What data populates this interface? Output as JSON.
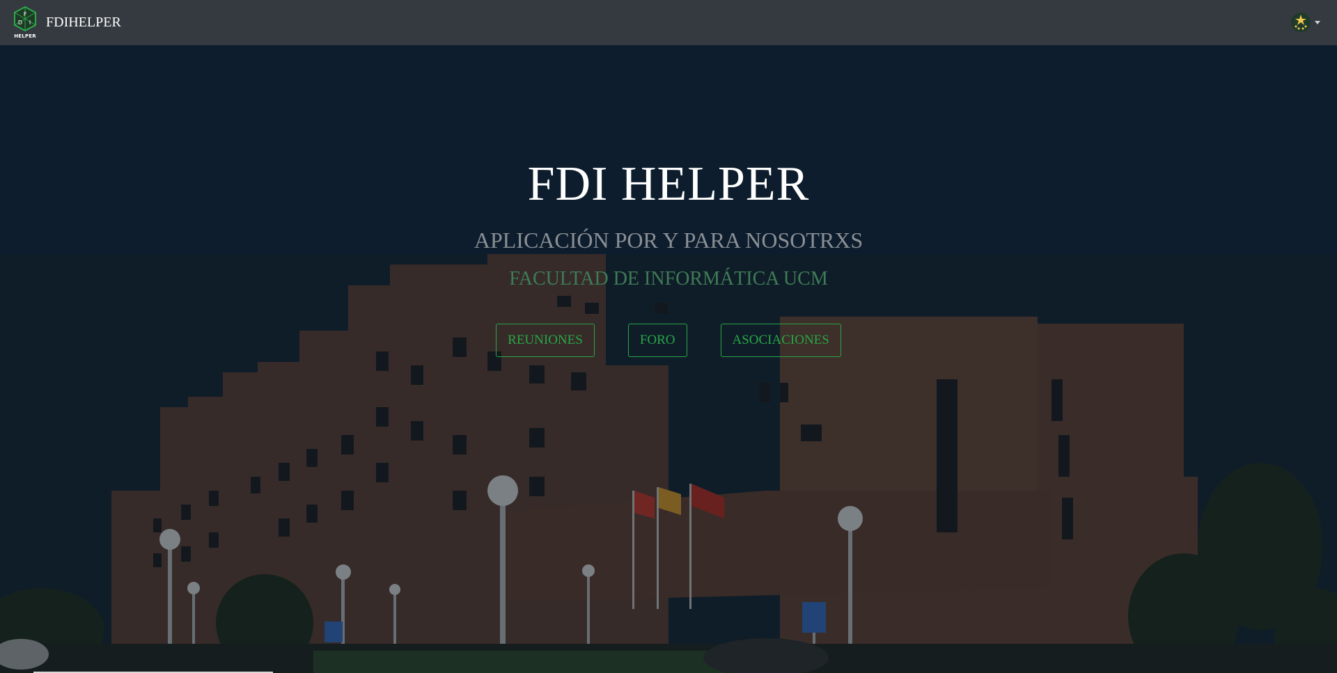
{
  "navbar": {
    "logo_letters": [
      "F",
      "D",
      "I"
    ],
    "logo_caption": "HELPER",
    "brand_text": "FDIHELPER",
    "user_menu_icon": "user-avatar-icon",
    "dropdown_icon": "chevron-down-icon"
  },
  "hero": {
    "title": "FDI HELPER",
    "subtitle": "APLICACIÓN POR Y PARA NOSOTRXS",
    "faculty": "FACULTAD DE INFORMÁTICA UCM",
    "buttons": [
      {
        "label": "REUNIONES"
      },
      {
        "label": "FORO"
      },
      {
        "label": "ASOCIACIONES"
      }
    ],
    "background_image": "faculty-building-photo"
  },
  "colors": {
    "navbar_bg": "#343a40",
    "accent_green": "#28a745",
    "title_white": "#ffffff",
    "subtitle_gray": "#8a8f94",
    "faculty_green": "#3f7b56"
  }
}
